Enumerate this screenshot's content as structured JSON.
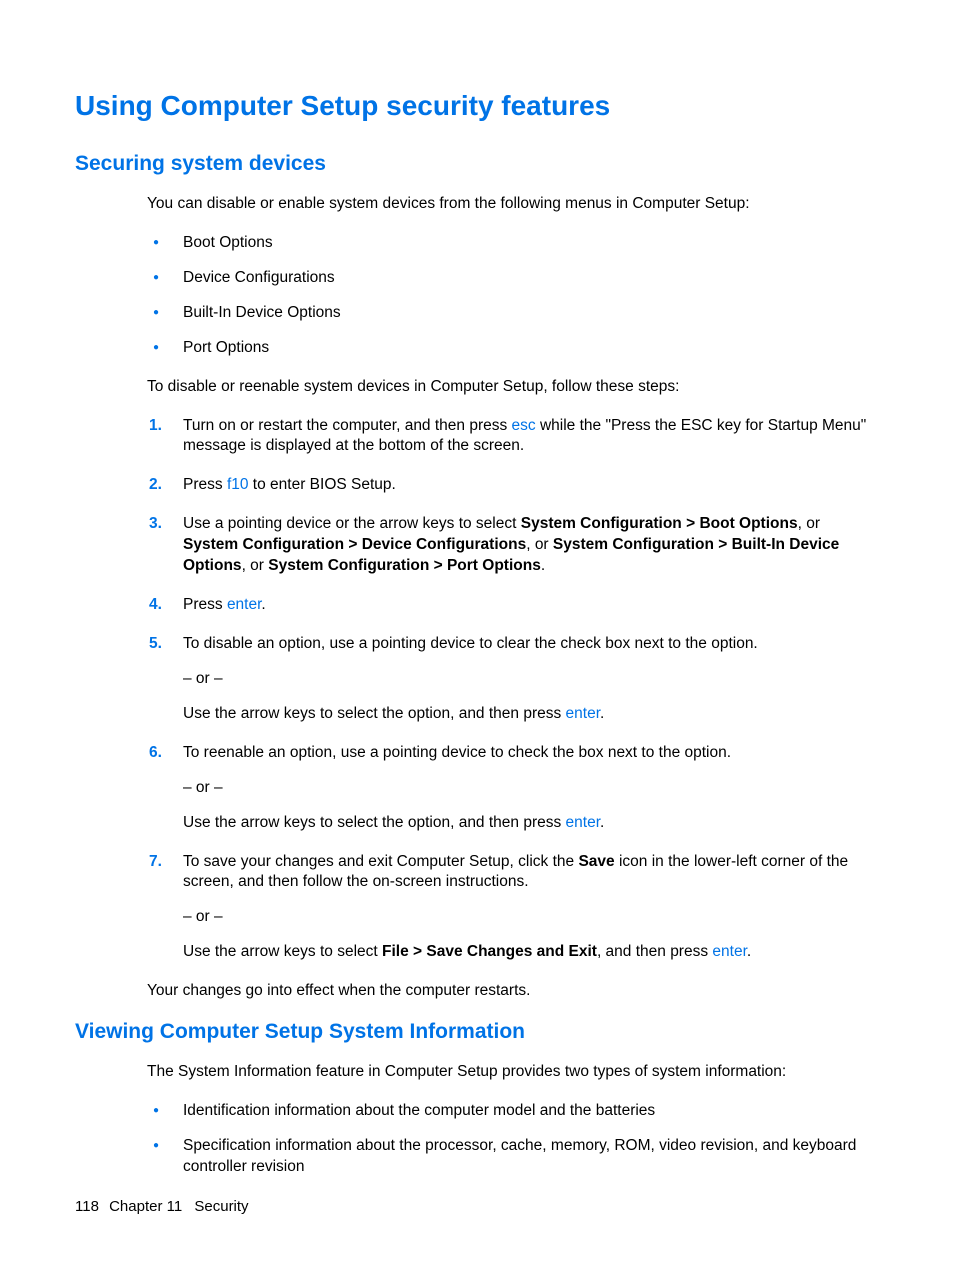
{
  "title": "Using Computer Setup security features",
  "section1": {
    "heading": "Securing system devices",
    "intro": "You can disable or enable system devices from the following menus in Computer Setup:",
    "menus": [
      "Boot Options",
      "Device Configurations",
      "Built-In Device Options",
      "Port Options"
    ],
    "steps_intro": "To disable or reenable system devices in Computer Setup, follow these steps:",
    "step1_a": "Turn on or restart the computer, and then press ",
    "step1_key": "esc",
    "step1_b": " while the \"Press the ESC key for Startup Menu\" message is displayed at the bottom of the screen.",
    "step2_a": "Press ",
    "step2_key": "f10",
    "step2_b": " to enter BIOS Setup.",
    "step3_a": "Use a pointing device or the arrow keys to select ",
    "step3_b1": "System Configuration > Boot Options",
    "step3_or1": ", or ",
    "step3_b2": "System Configuration > Device Configurations",
    "step3_or2": ", or ",
    "step3_b3": "System Configuration > Built-In Device Options",
    "step3_or3": ", or ",
    "step3_b4": "System Configuration > Port Options",
    "step3_end": ".",
    "step4_a": "Press ",
    "step4_key": "enter",
    "step4_b": ".",
    "step5_a": "To disable an option, use a pointing device to clear the check box next to the option.",
    "or": "– or –",
    "step5_b": "Use the arrow keys to select the option, and then press ",
    "step5_key": "enter",
    "step5_c": ".",
    "step6_a": "To reenable an option, use a pointing device to check the box next to the option.",
    "step6_b": "Use the arrow keys to select the option, and then press ",
    "step6_key": "enter",
    "step6_c": ".",
    "step7_a": "To save your changes and exit Computer Setup, click the ",
    "step7_save": "Save",
    "step7_b": " icon in the lower-left corner of the screen, and then follow the on-screen instructions.",
    "step7_c": "Use the arrow keys to select ",
    "step7_file": "File > Save Changes and Exit",
    "step7_d": ", and then press ",
    "step7_key": "enter",
    "step7_e": ".",
    "outro": "Your changes go into effect when the computer restarts."
  },
  "section2": {
    "heading": "Viewing Computer Setup System Information",
    "intro": "The System Information feature in Computer Setup provides two types of system information:",
    "bullets": [
      "Identification information about the computer model and the batteries",
      "Specification information about the processor, cache, memory, ROM, video revision, and keyboard controller revision"
    ]
  },
  "footer": {
    "page": "118",
    "chapter": "Chapter 11",
    "title": "Security"
  }
}
